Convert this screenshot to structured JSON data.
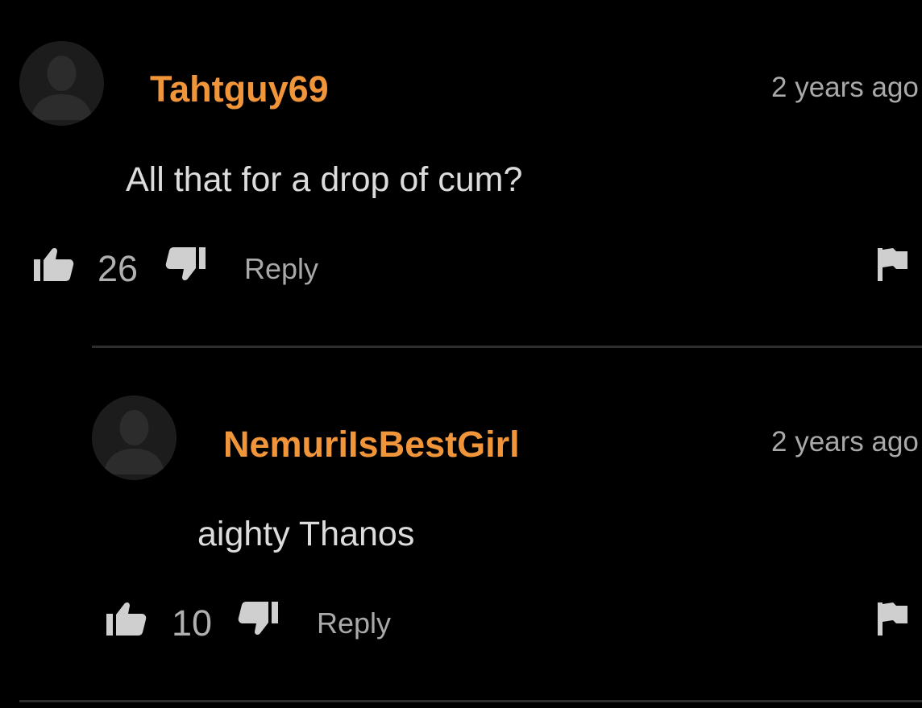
{
  "comments": [
    {
      "username": "Tahtguy69",
      "timestamp": "2 years ago",
      "text": "All that for a drop of cum?",
      "likes": "26",
      "reply_label": "Reply",
      "avatar_icon": "default-avatar-icon",
      "like_icon": "thumbs-up-icon",
      "dislike_icon": "thumbs-down-icon",
      "flag_icon": "flag-icon"
    },
    {
      "username": "NemuriIsBestGirl",
      "timestamp": "2 years ago",
      "text": "aighty Thanos",
      "likes": "10",
      "reply_label": "Reply",
      "avatar_icon": "default-avatar-icon",
      "like_icon": "thumbs-up-icon",
      "dislike_icon": "thumbs-down-icon",
      "flag_icon": "flag-icon"
    }
  ],
  "colors": {
    "background": "#000000",
    "username": "#f0953a",
    "timestamp": "#a9a9a9",
    "body_text": "#dcdcdc",
    "icons": "#cfcfcf",
    "divider": "#2e2e2e"
  }
}
